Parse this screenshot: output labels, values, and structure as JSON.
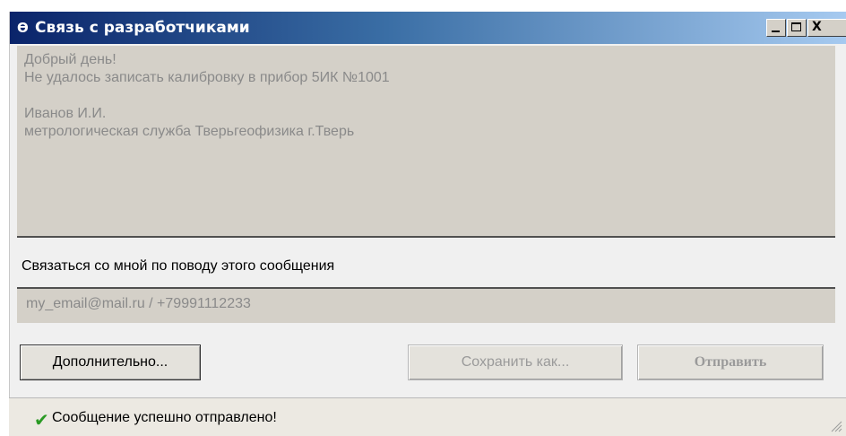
{
  "window": {
    "title": "Связь с разработчиками",
    "app_icon": "db-icon",
    "controls": {
      "minimize": "minimize-icon",
      "maximize": "maximize-icon",
      "close_label": "X"
    }
  },
  "message": {
    "text": "Добрый день!\nНе удалось записать калибровку в прибор 5ИК №1001\n\nИванов И.И.\nметрологическая служба Тверьгеофизика г.Тверь"
  },
  "contact": {
    "label": "Связаться со мной по поводу этого сообщения",
    "value": "my_email@mail.ru  /  +79991112233"
  },
  "buttons": {
    "more": "Дополнительно...",
    "save_as": "Сохранить как...",
    "send": "Отправить"
  },
  "status": {
    "icon": "checkmark-icon",
    "text": "Сообщение успешно отправлено!"
  },
  "colors": {
    "titlebar_start": "#0a246a",
    "titlebar_end": "#a6caf0",
    "readonly_field": "#d4d0c8",
    "success": "#2a9a24"
  }
}
